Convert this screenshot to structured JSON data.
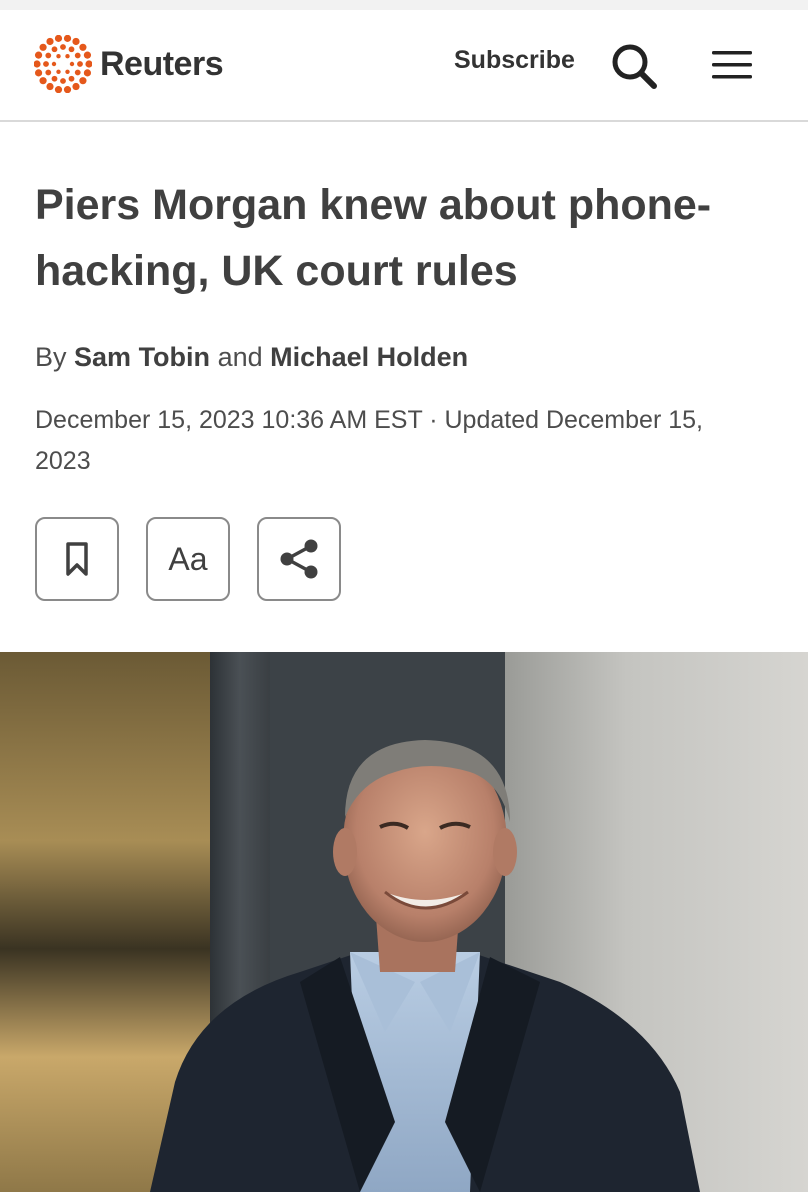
{
  "header": {
    "brand": "Reuters",
    "subscribe_label": "Subscribe",
    "logo_color": "#E5581B"
  },
  "article": {
    "headline": "Piers Morgan knew about phone-hacking, UK court rules",
    "byline_prefix": "By",
    "author_1": "Sam Tobin",
    "byline_joiner": "and",
    "author_2": "Michael Holden",
    "dateline": "December 15, 2023 10:36 AM EST · Updated December 15, 2023"
  },
  "toolbar": {
    "font_label": "Aa"
  },
  "icons": {
    "search": "search-icon",
    "menu": "hamburger-menu-icon",
    "bookmark": "bookmark-icon",
    "share": "share-icon"
  }
}
